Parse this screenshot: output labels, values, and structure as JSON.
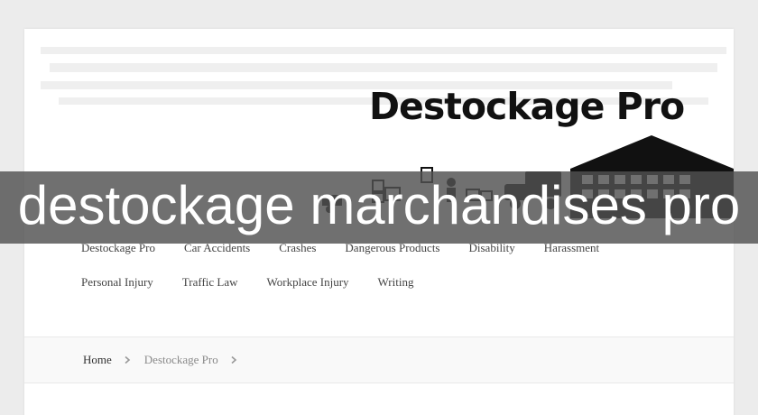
{
  "site": {
    "logo_title": "Destockage Pro"
  },
  "nav": {
    "row1": [
      "Destockage Pro",
      "Car Accidents",
      "Crashes",
      "Dangerous Products",
      "Disability",
      "Harassment"
    ],
    "row2": [
      "Personal Injury",
      "Traffic Law",
      "Workplace Injury",
      "Writing"
    ]
  },
  "breadcrumb": {
    "home": "Home",
    "current": "Destockage Pro"
  },
  "banner": {
    "text": "destockage marchandises pro",
    "background": "#505050"
  },
  "colors": {
    "page_bg": "#ececec",
    "card_bg": "#ffffff",
    "nav_text": "#444444",
    "crumb_muted": "#8a8a8a"
  }
}
